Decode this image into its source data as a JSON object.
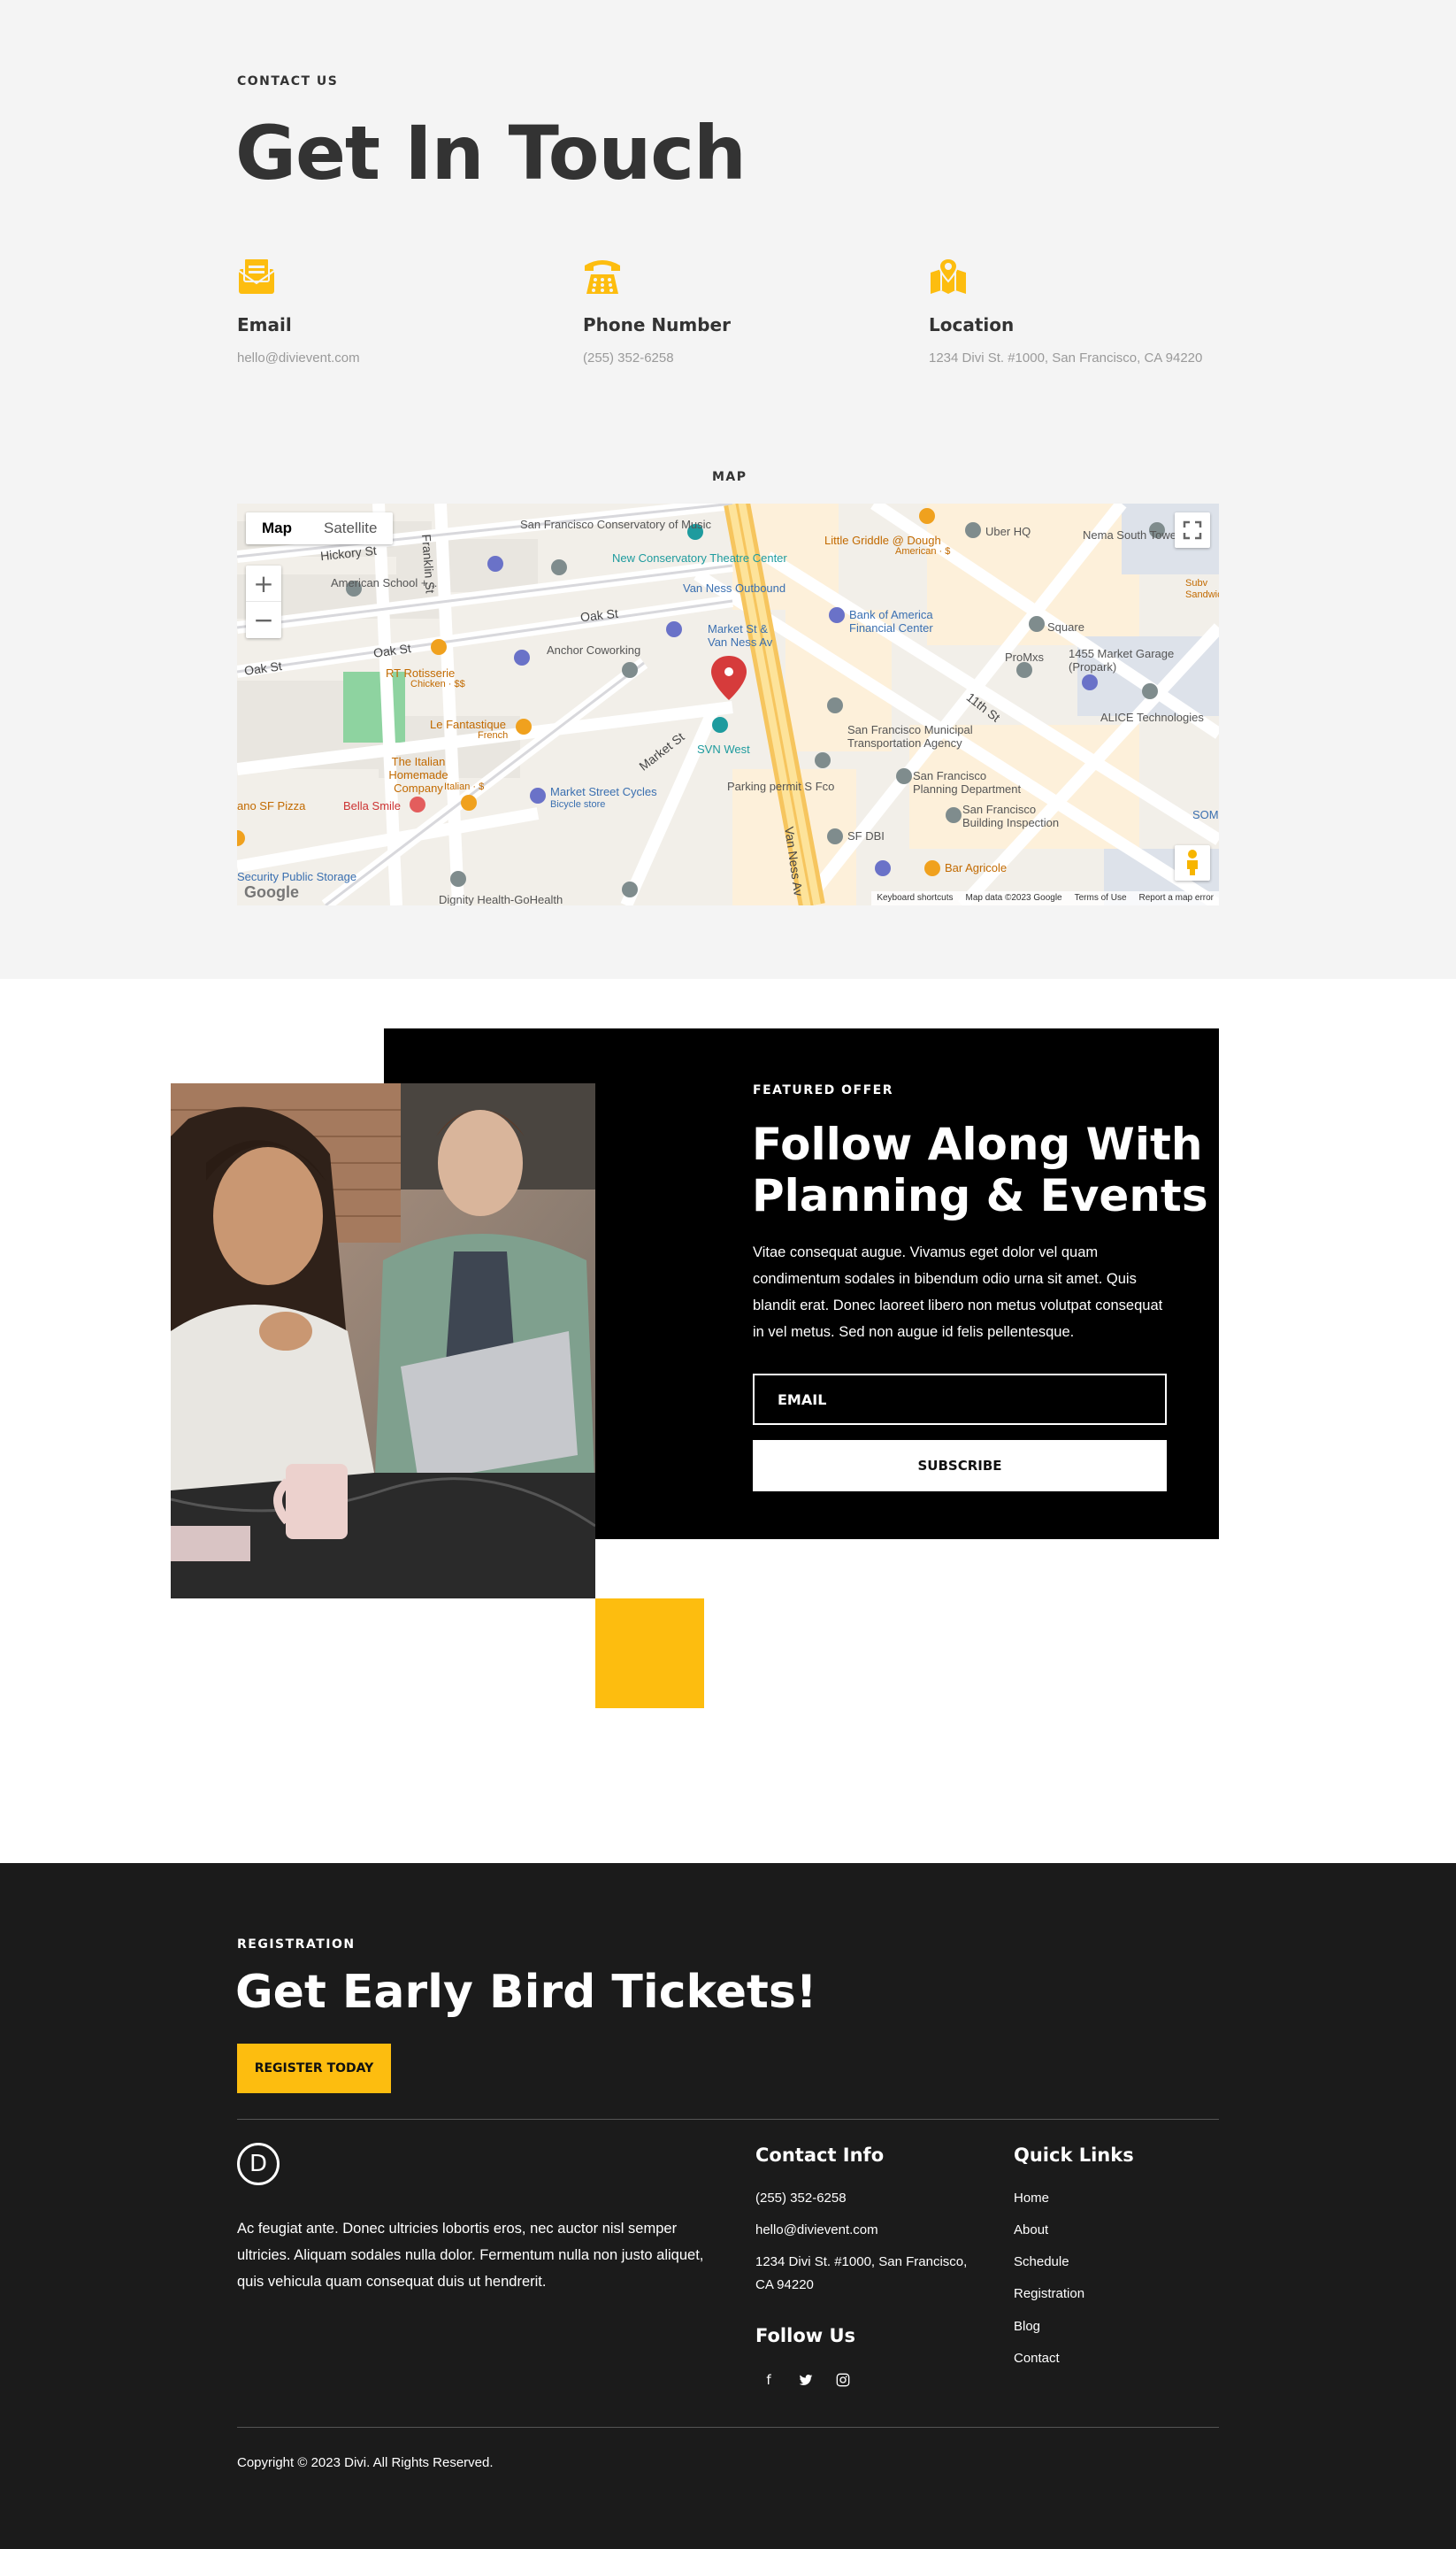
{
  "contact": {
    "eyebrow": "CONTACT US",
    "title": "Get In Touch",
    "items": [
      {
        "icon": "envelope-icon",
        "title": "Email",
        "text": "hello@divievent.com"
      },
      {
        "icon": "telephone-icon",
        "title": "Phone Number",
        "text": "(255) 352-6258"
      },
      {
        "icon": "map-location-icon",
        "title": "Location",
        "text": "1234 Divi St. #1000, San Francisco, CA 94220"
      }
    ],
    "accent": "#fdbd0f"
  },
  "map": {
    "heading": "MAP",
    "tabs": [
      "Map",
      "Satellite"
    ],
    "zoom_in": "+",
    "zoom_out": "−",
    "attribution": "Google",
    "footer_links": [
      "Keyboard shortcuts",
      "Map data ©2023 Google",
      "Terms of Use",
      "Report a map error"
    ],
    "labels": {
      "hickory": "Hickory St",
      "franklin": "Franklin St",
      "american_school": "American School +...",
      "sf_conservatory": "San Francisco Conservatory of Music",
      "new_conservatory": "New Conservatory Theatre Center",
      "van_ness_outbound": "Van Ness Outbound",
      "little_griddle": "Little Griddle @ Dough",
      "little_griddle_sub": "American · $",
      "uber": "Uber HQ",
      "nema": "Nema South Tower",
      "oak1": "Oak St",
      "oak2": "Oak St",
      "oak3": "Oak St",
      "anchor": "Anchor Coworking",
      "market_van_ness": "Market St & Van Ness Av",
      "bank_of_america": "Bank of America Financial Center",
      "square": "Square",
      "market_1455": "1455 Market Garage (Propark)",
      "promxs": "ProMxs",
      "alice": "ALICE Technologies",
      "rt_rotisserie": "RT Rotisserie",
      "rt_sub": "Chicken · $$",
      "le_fantastique": "Le Fantastique",
      "le_fantastique_sub": "French",
      "market_st": "Market St",
      "svn_west": "SVN West",
      "sf_mta": "San Francisco Municipal Transportation Agency",
      "eleventh": "11th St",
      "italian": "The Italian Homemade Company",
      "italian_sub": "Italian · $",
      "parking": "Parking permit S Fco",
      "sf_planning": "San Francisco Planning Department",
      "sf_building": "San Francisco Building Inspection",
      "market_cycles": "Market Street Cycles",
      "cycles_sub": "Bicycle store",
      "bella_smile": "Bella Smile",
      "ano_pizza": "ano SF Pizza",
      "van_ness_av": "Van Ness Av",
      "sf_dbi": "SF DBI",
      "bar_agricole": "Bar Agricole",
      "security_public": "Security Public Storage",
      "dignity": "Dignity Health-GoHealth",
      "som": "SOM",
      "subv": "Subv Sandwic"
    }
  },
  "featured": {
    "eyebrow": "FEATURED OFFER",
    "title_line1": "Follow Along With",
    "title_line2": "Planning & Events",
    "body": "Vitae consequat augue. Vivamus eget dolor vel quam condimentum sodales in bibendum odio urna sit amet. Quis blandit erat. Donec laoreet libero non metus volutpat consequat in vel metus. Sed non augue id felis pellentesque.",
    "email_placeholder": "EMAIL",
    "subscribe_label": "SUBSCRIBE"
  },
  "footer": {
    "eyebrow": "REGISTRATION",
    "title": "Get Early Bird Tickets!",
    "register_label": "REGISTER TODAY",
    "logo_letter": "D",
    "about": "Ac feugiat ante. Donec ultricies lobortis eros, nec auctor nisl semper ultricies. Aliquam sodales nulla dolor. Fermentum nulla non justo aliquet, quis vehicula quam consequat duis ut hendrerit.",
    "contact_heading": "Contact Info",
    "phone": "(255) 352-6258",
    "email": "hello@divievent.com",
    "address": "1234 Divi St. #1000, San Francisco, CA 94220",
    "follow_heading": "Follow Us",
    "social": [
      {
        "icon": "facebook-icon",
        "glyph": "f"
      },
      {
        "icon": "twitter-icon",
        "glyph": "t"
      },
      {
        "icon": "instagram-icon",
        "glyph": "◎"
      }
    ],
    "links_heading": "Quick Links",
    "links": [
      "Home",
      "About",
      "Schedule",
      "Registration",
      "Blog",
      "Contact"
    ],
    "copyright": "Copyright © 2023 Divi. All Rights Reserved."
  }
}
